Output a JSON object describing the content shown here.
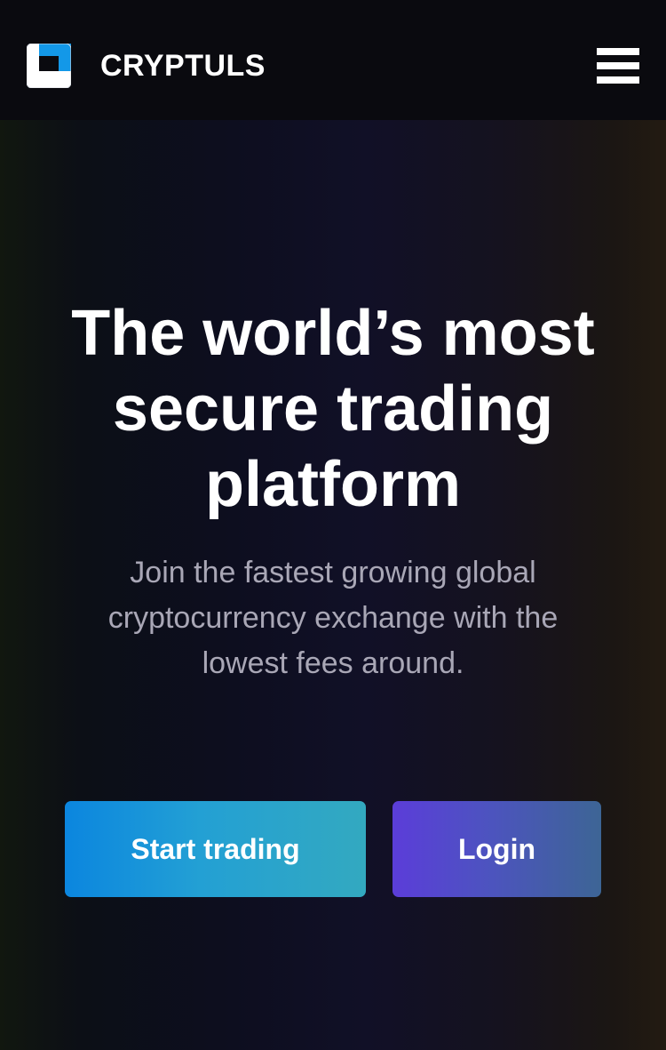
{
  "header": {
    "brand": "CRYPTULS",
    "logo_icon": "cryptuls-logo-icon",
    "menu_icon": "hamburger-menu-icon"
  },
  "hero": {
    "headline": "The world’s most secure trading platform",
    "subtext": "Join the fastest growing global cryptocurrency exchange with the lowest fees around."
  },
  "buttons": {
    "start_label": "Start trading",
    "login_label": "Login"
  },
  "colors": {
    "header_background": "#0a0a0f",
    "accent_blue": "#1e93db",
    "accent_purple": "#5b3dd9",
    "text_muted": "#a9a7b6"
  }
}
